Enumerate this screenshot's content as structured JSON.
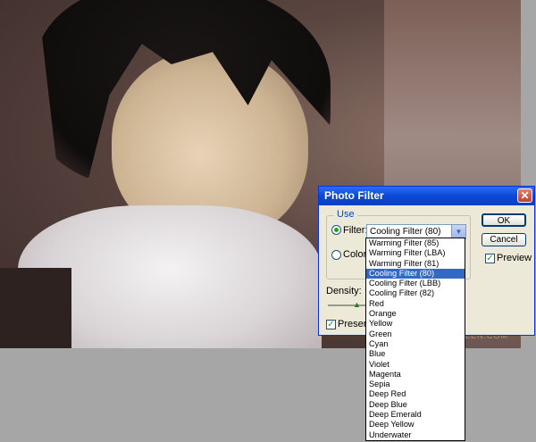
{
  "photo": {
    "watermark": "EEN.COM"
  },
  "dialog": {
    "title": "Photo Filter",
    "close_glyph": "✕",
    "use_group_label": "Use",
    "filter_label": "Filter:",
    "filter_value": "Cooling Filter (80)",
    "color_label": "Color:",
    "density_label": "Density:",
    "preserve_label": "Preserve",
    "ok_label": "OK",
    "cancel_label": "Cancel",
    "preview_label": "Preview",
    "checkbox_glyph": "✓",
    "dropdown_arrow": "▼",
    "slider_glyph": "▲",
    "colors": {
      "title_bar": "#0a49d6",
      "selection": "#316ac5",
      "dialog_bg": "#ece9d8"
    }
  },
  "dropdown": {
    "selected_index": 3,
    "items": [
      "Warming Filter (85)",
      "Warming Filter (LBA)",
      "Warming Filter (81)",
      "Cooling Filter (80)",
      "Cooling Filter (LBB)",
      "Cooling Filter (82)",
      "Red",
      "Orange",
      "Yellow",
      "Green",
      "Cyan",
      "Blue",
      "Violet",
      "Magenta",
      "Sepia",
      "Deep Red",
      "Deep Blue",
      "Deep Emerald",
      "Deep Yellow",
      "Underwater"
    ]
  }
}
